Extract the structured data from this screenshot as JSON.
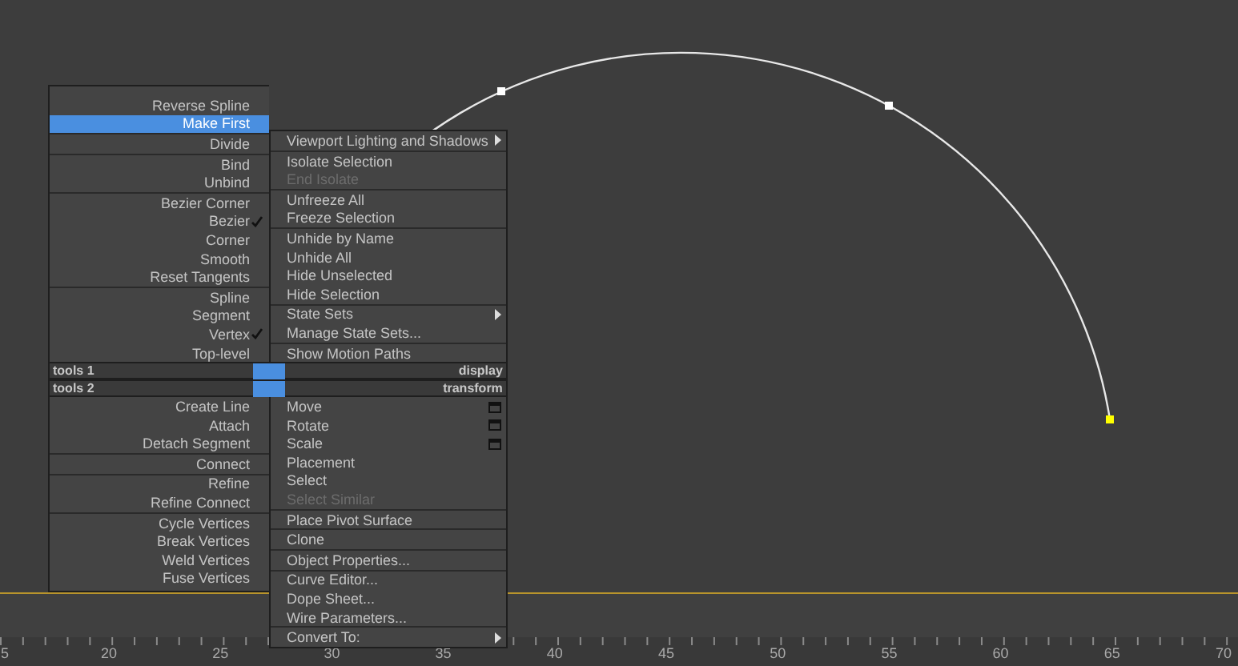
{
  "viewport": {
    "spline_vertices": [
      {
        "selected": false
      },
      {
        "selected": false
      },
      {
        "selected": true
      }
    ]
  },
  "quad_menu": {
    "tools1": {
      "title": "tools 1",
      "groups": [
        {
          "items": [
            {
              "label": "Reverse Spline",
              "selected": false,
              "checked": false
            },
            {
              "label": "Make First",
              "selected": true,
              "checked": false
            }
          ]
        },
        {
          "items": [
            {
              "label": "Divide",
              "selected": false,
              "checked": false
            }
          ]
        },
        {
          "items": [
            {
              "label": "Bind",
              "selected": false,
              "checked": false
            },
            {
              "label": "Unbind",
              "selected": false,
              "checked": false
            }
          ]
        },
        {
          "items": [
            {
              "label": "Bezier Corner",
              "selected": false,
              "checked": false
            },
            {
              "label": "Bezier",
              "selected": false,
              "checked": true
            },
            {
              "label": "Corner",
              "selected": false,
              "checked": false
            },
            {
              "label": "Smooth",
              "selected": false,
              "checked": false
            },
            {
              "label": "Reset Tangents",
              "selected": false,
              "checked": false
            }
          ]
        },
        {
          "items": [
            {
              "label": "Spline",
              "selected": false,
              "checked": false
            },
            {
              "label": "Segment",
              "selected": false,
              "checked": false
            },
            {
              "label": "Vertex",
              "selected": false,
              "checked": true
            },
            {
              "label": "Top-level",
              "selected": false,
              "checked": false
            }
          ]
        }
      ]
    },
    "tools2": {
      "title": "tools 2",
      "groups": [
        {
          "items": [
            {
              "label": "Create Line",
              "selected": false,
              "checked": false
            },
            {
              "label": "Attach",
              "selected": false,
              "checked": false
            },
            {
              "label": "Detach Segment",
              "selected": false,
              "checked": false
            }
          ]
        },
        {
          "items": [
            {
              "label": "Connect",
              "selected": false,
              "checked": false
            }
          ]
        },
        {
          "items": [
            {
              "label": "Refine",
              "selected": false,
              "checked": false
            },
            {
              "label": "Refine Connect",
              "selected": false,
              "checked": false
            }
          ]
        },
        {
          "items": [
            {
              "label": "Cycle Vertices",
              "selected": false,
              "checked": false
            },
            {
              "label": "Break Vertices",
              "selected": false,
              "checked": false
            },
            {
              "label": "Weld Vertices",
              "selected": false,
              "checked": false
            },
            {
              "label": "Fuse Vertices",
              "selected": false,
              "checked": false
            }
          ]
        }
      ]
    },
    "display": {
      "title": "display",
      "groups": [
        {
          "items": [
            {
              "label": "Viewport Lighting and Shadows",
              "kind": "submenu",
              "selected": false,
              "disabled": false
            }
          ]
        },
        {
          "items": [
            {
              "label": "Isolate Selection",
              "kind": "plain",
              "selected": false,
              "disabled": false
            },
            {
              "label": "End Isolate",
              "kind": "plain",
              "selected": false,
              "disabled": true
            }
          ]
        },
        {
          "items": [
            {
              "label": "Unfreeze All",
              "kind": "plain",
              "selected": false,
              "disabled": false
            },
            {
              "label": "Freeze Selection",
              "kind": "plain",
              "selected": false,
              "disabled": false
            }
          ]
        },
        {
          "items": [
            {
              "label": "Unhide by Name",
              "kind": "plain",
              "selected": false,
              "disabled": false
            },
            {
              "label": "Unhide All",
              "kind": "plain",
              "selected": false,
              "disabled": false
            },
            {
              "label": "Hide Unselected",
              "kind": "plain",
              "selected": false,
              "disabled": false
            },
            {
              "label": "Hide Selection",
              "kind": "plain",
              "selected": false,
              "disabled": false
            }
          ]
        },
        {
          "items": [
            {
              "label": "State Sets",
              "kind": "submenu",
              "selected": false,
              "disabled": false
            },
            {
              "label": "Manage State Sets...",
              "kind": "plain",
              "selected": false,
              "disabled": false
            }
          ]
        },
        {
          "items": [
            {
              "label": "Show Motion Paths",
              "kind": "plain",
              "selected": false,
              "disabled": false
            }
          ]
        }
      ]
    },
    "transform": {
      "title": "transform",
      "groups": [
        {
          "items": [
            {
              "label": "Move",
              "kind": "option",
              "selected": false,
              "disabled": false
            },
            {
              "label": "Rotate",
              "kind": "option",
              "selected": false,
              "disabled": false
            },
            {
              "label": "Scale",
              "kind": "option",
              "selected": false,
              "disabled": false
            },
            {
              "label": "Placement",
              "kind": "plain",
              "selected": false,
              "disabled": false
            },
            {
              "label": "Select",
              "kind": "plain",
              "selected": false,
              "disabled": false
            },
            {
              "label": "Select Similar",
              "kind": "plain",
              "selected": false,
              "disabled": true
            }
          ]
        },
        {
          "items": [
            {
              "label": "Place Pivot Surface",
              "kind": "plain",
              "selected": false,
              "disabled": false
            }
          ]
        },
        {
          "items": [
            {
              "label": "Clone",
              "kind": "plain",
              "selected": false,
              "disabled": false
            }
          ]
        },
        {
          "items": [
            {
              "label": "Object Properties...",
              "kind": "plain",
              "selected": false,
              "disabled": false
            }
          ]
        },
        {
          "items": [
            {
              "label": "Curve Editor...",
              "kind": "plain",
              "selected": false,
              "disabled": false
            },
            {
              "label": "Dope Sheet...",
              "kind": "plain",
              "selected": false,
              "disabled": false
            },
            {
              "label": "Wire Parameters...",
              "kind": "plain",
              "selected": false,
              "disabled": false
            }
          ]
        },
        {
          "items": [
            {
              "label": "Convert To:",
              "kind": "submenu",
              "selected": false,
              "disabled": false
            }
          ]
        }
      ]
    }
  },
  "ruler": {
    "labels": [
      "5",
      "20",
      "25",
      "30",
      "35",
      "40",
      "45",
      "50",
      "55",
      "60",
      "65",
      "70"
    ]
  }
}
